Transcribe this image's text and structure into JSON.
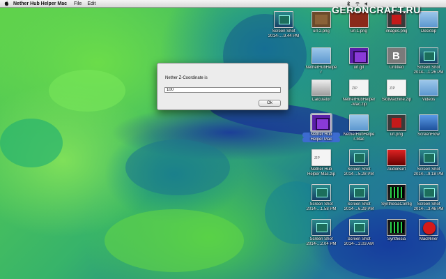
{
  "menubar": {
    "app_name": "Nether Hub Helper Mac",
    "items": [
      "File",
      "Edit"
    ]
  },
  "watermark": "GERONCRAFT.RU",
  "dialog": {
    "prompt": "Nether Z-Coordinate is",
    "input_value": "100",
    "ok_label": "Ok"
  },
  "desktop_icons": [
    {
      "label": "Screen Shot",
      "sublabel": "2014-....9.44 PM",
      "kind": "screenshot"
    },
    {
      "label": "url-2.png",
      "sublabel": "",
      "kind": "block"
    },
    {
      "label": "url-1.png",
      "sublabel": "",
      "kind": "wood"
    },
    {
      "label": "images.png",
      "sublabel": "",
      "kind": "redstone"
    },
    {
      "label": "Desktop",
      "sublabel": "",
      "kind": "folder"
    },
    {
      "label": "NetherHubHelpe",
      "sublabel": "r",
      "kind": "folder"
    },
    {
      "label": "url.gif",
      "sublabel": "",
      "kind": "portal"
    },
    {
      "label": "Untitled",
      "sublabel": "",
      "kind": "bitcoin"
    },
    {
      "label": "Screen Shot",
      "sublabel": "2014-...1.26 PM",
      "kind": "screenshot"
    },
    {
      "label": "Calculator",
      "sublabel": "",
      "kind": "calculator"
    },
    {
      "label": "NetherHubHelper",
      "sublabel": "-Mac.zip",
      "kind": "zip"
    },
    {
      "label": "SlotMachine.zip",
      "sublabel": "",
      "kind": "zip"
    },
    {
      "label": "Videos",
      "sublabel": "",
      "kind": "folder"
    },
    {
      "label": "Nether Hub",
      "sublabel": "Helper Mac",
      "kind": "portal"
    },
    {
      "label": "NetherHubHelpe",
      "sublabel": "r-Mac",
      "kind": "folder"
    },
    {
      "label": "url.png",
      "sublabel": "",
      "kind": "redstone"
    },
    {
      "label": "ScreenFlow",
      "sublabel": "",
      "kind": "screenflow"
    },
    {
      "label": "Nether Hub",
      "sublabel": "Helper Mac.zip",
      "kind": "zip"
    },
    {
      "label": "Screen Shot",
      "sublabel": "2014-...5.28 PM",
      "kind": "screenshot"
    },
    {
      "label": "AudioSurf",
      "sublabel": "",
      "kind": "audiosurf"
    },
    {
      "label": "Screen Shot",
      "sublabel": "2014-...9.18 PM",
      "kind": "screenshot"
    },
    {
      "label": "Screen Shot",
      "sublabel": "2014-...1.58 PM",
      "kind": "screenshot"
    },
    {
      "label": "Screen Shot",
      "sublabel": "2014-...6.29 PM",
      "kind": "screenshot"
    },
    {
      "label": "SynthesiaConfig",
      "sublabel": "",
      "kind": "synthesia"
    },
    {
      "label": "Screen Shot",
      "sublabel": "2014-...3.46 PM",
      "kind": "screenshot"
    },
    {
      "label": "Screen Shot",
      "sublabel": "2014-...2.04 PM",
      "kind": "screenshot"
    },
    {
      "label": "Screen Shot",
      "sublabel": "2014-...2.03 AM",
      "kind": "screenshot"
    },
    {
      "label": "Synthesia",
      "sublabel": "",
      "kind": "synthesia"
    },
    {
      "label": "MacMiner",
      "sublabel": "",
      "kind": "apple"
    }
  ]
}
